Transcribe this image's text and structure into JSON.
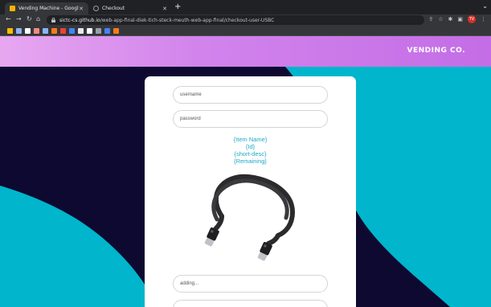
{
  "browser": {
    "tabs": [
      {
        "title": "Vending Machine - Google Sli",
        "favicon_color": "#f4b400",
        "active": true
      },
      {
        "title": "Checkout",
        "favicon_color": "#9aa0a6",
        "active": false
      }
    ],
    "address": {
      "host": "sictc-cs.github.io",
      "path": "/web-app-final-diek-tich-steck-meuth-web-app-final/checkout-user-USBC"
    },
    "profile_initial": "TV",
    "bookmark_colors": [
      "#fbbc04",
      "#8ab4f8",
      "#ffffff",
      "#f28b82",
      "#8ab4f8",
      "#fa7b17",
      "#ea4335",
      "#4285f4",
      "#e8eaed",
      "#ffffff",
      "#9aa0a6",
      "#4285f4",
      "#fa7b17"
    ]
  },
  "site": {
    "brand": "VENDING CO.",
    "form": {
      "username_placeholder": "username",
      "password_placeholder": "password",
      "adding_placeholder": "adding..."
    },
    "item": {
      "name": "{Item Name}",
      "id": "{Id}",
      "short_desc": "{short-desc}",
      "remaining": "{Remaining}",
      "image": "usb-c-cable-icon"
    }
  },
  "colors": {
    "header_start": "#e7a7f0",
    "header_end": "#c46de6",
    "navy": "#0d0930",
    "teal": "#00b5cc",
    "item_text": "#1fa8c4"
  }
}
